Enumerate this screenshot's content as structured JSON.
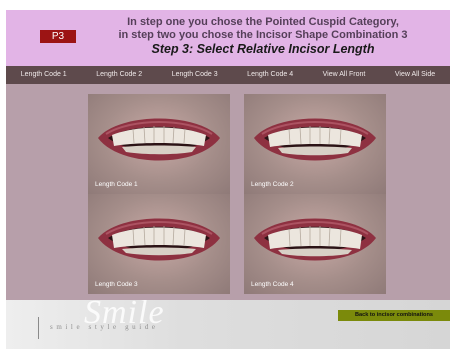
{
  "header": {
    "badge": "P3",
    "line1": "In step one you chose the Pointed Cuspid Category,",
    "line2": "in step two you chose the Incisor Shape Combination 3",
    "line3": "Step 3: Select Relative Incisor Length"
  },
  "nav": [
    "Length Code 1",
    "Length Code 2",
    "Length Code 3",
    "Length Code 4",
    "View All Front",
    "View All Side"
  ],
  "tiles": [
    "Length Code 1",
    "Length Code 2",
    "Length Code 3",
    "Length Code 4"
  ],
  "footer": {
    "brand_watermark": "Smile",
    "brand_tagline": "smile style guide",
    "back_button": "Back to incisor combinations"
  },
  "colors": {
    "header_bg": "#e2b4e6",
    "badge_bg": "#9c1414",
    "nav_bg": "#5e4a4c",
    "main_bg": "#b79faa",
    "back_button_bg": "#7b8a0b"
  }
}
